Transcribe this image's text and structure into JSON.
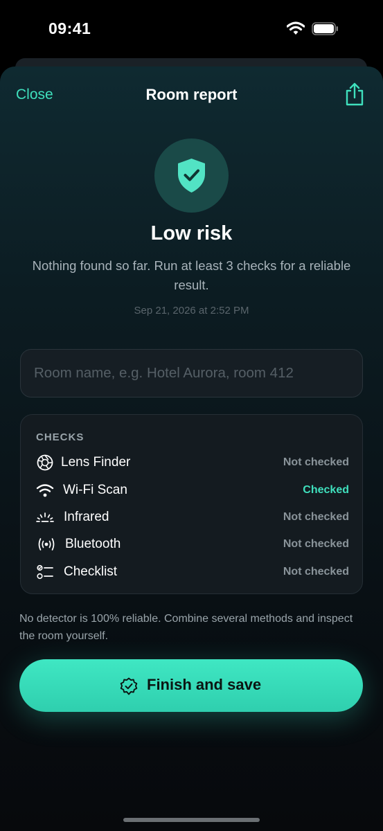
{
  "status_bar": {
    "time": "09:41"
  },
  "nav": {
    "close_label": "Close",
    "title": "Room report"
  },
  "risk": {
    "title": "Low risk",
    "description": "Nothing found so far. Run at least 3 checks for a reliable result.",
    "date": "Sep 21, 2026 at 2:52 PM"
  },
  "room_input": {
    "value": "",
    "placeholder": "Room name, e.g. Hotel Aurora, room 412"
  },
  "checks": {
    "header": "CHECKS",
    "items": [
      {
        "label": "Lens Finder",
        "icon": "aperture-icon",
        "status": "Not checked"
      },
      {
        "label": "Wi-Fi Scan",
        "icon": "wifi-icon",
        "status": "Checked"
      },
      {
        "label": "Infrared",
        "icon": "infrared-icon",
        "status": "Not checked"
      },
      {
        "label": "Bluetooth",
        "icon": "bluetooth-signal-icon",
        "status": "Not checked"
      },
      {
        "label": "Checklist",
        "icon": "checklist-icon",
        "status": "Not checked"
      }
    ]
  },
  "disclaimer": "No detector is 100% reliable. Combine several methods and inspect the room yourself.",
  "finish_button": {
    "label": "Finish and save",
    "icon": "check-badge-icon"
  },
  "colors": {
    "accent": "#3fe0bd",
    "button": "#35d9b6",
    "shield": "#52e3c4"
  }
}
